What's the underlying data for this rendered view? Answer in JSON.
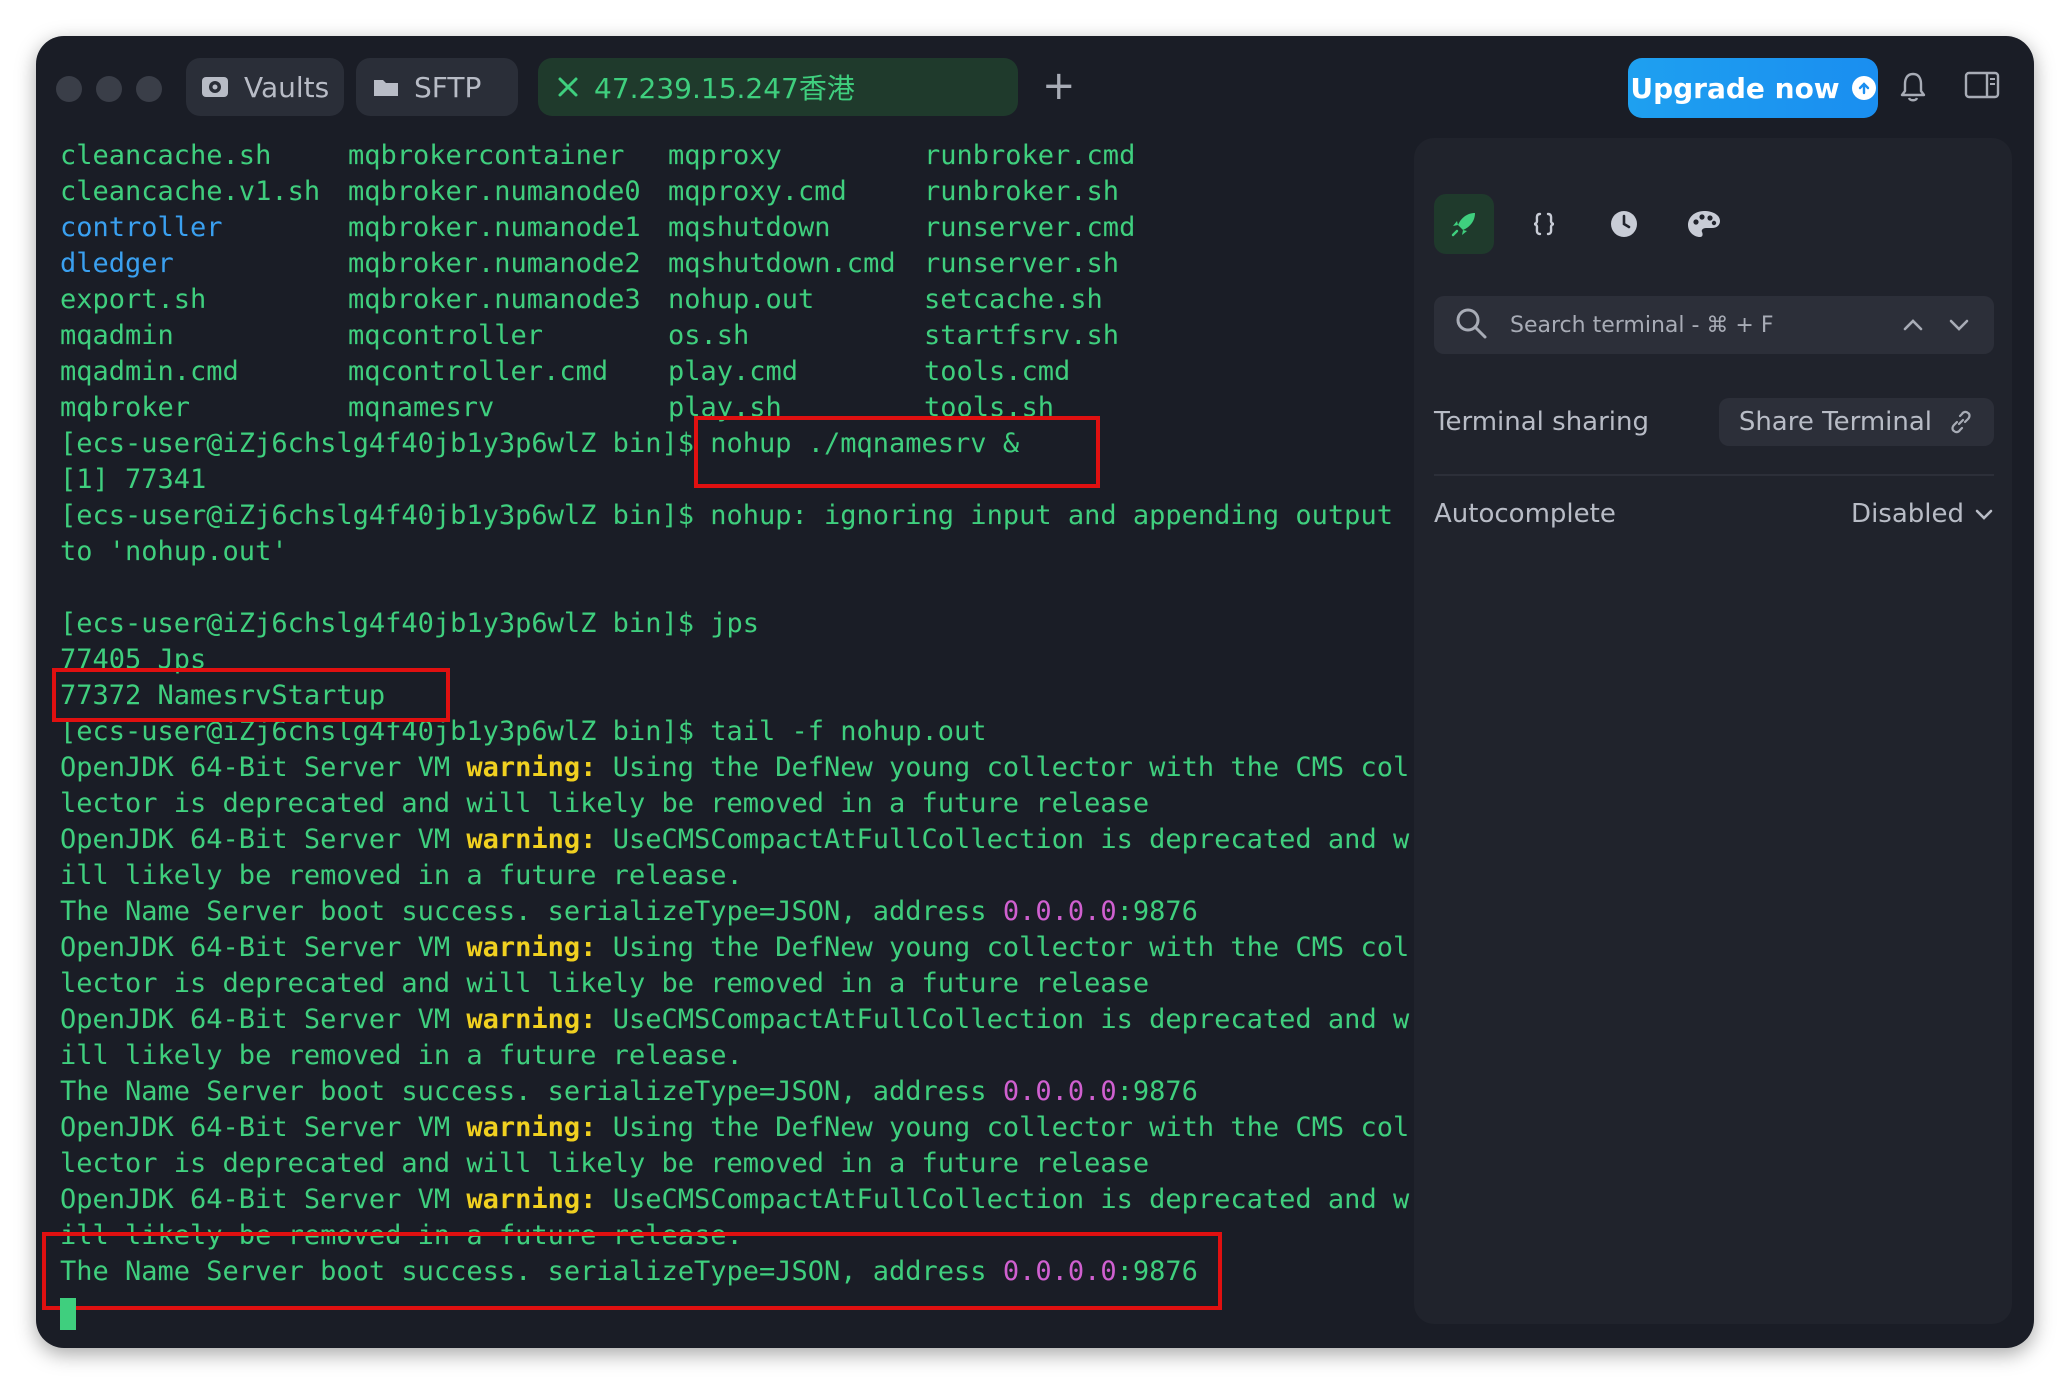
{
  "titlebar": {
    "tabs": [
      {
        "label": "Vaults",
        "icon": "vault-icon"
      },
      {
        "label": "SFTP",
        "icon": "folder-icon"
      },
      {
        "label": "47.239.15.247香港",
        "icon": "close-icon"
      }
    ],
    "upgrade_label": "Upgrade now"
  },
  "terminal": {
    "ls_columns": [
      [
        "cleancache.sh",
        "cleancache.v1.sh",
        "controller",
        "dledger",
        "export.sh",
        "mqadmin",
        "mqadmin.cmd",
        "mqbroker"
      ],
      [
        "mqbrokercontainer",
        "mqbroker.numanode0",
        "mqbroker.numanode1",
        "mqbroker.numanode2",
        "mqbroker.numanode3",
        "mqcontroller",
        "mqcontroller.cmd",
        "mqnamesrv"
      ],
      [
        "mqproxy",
        "mqproxy.cmd",
        "mqshutdown",
        "mqshutdown.cmd",
        "nohup.out",
        "os.sh",
        "play.cmd",
        "play.sh"
      ],
      [
        "runbroker.cmd",
        "runbroker.sh",
        "runserver.cmd",
        "runserver.sh",
        "setcache.sh",
        "startfsrv.sh",
        "tools.cmd",
        "tools.sh"
      ]
    ],
    "directories": [
      "controller",
      "dledger"
    ],
    "prompt": "[ecs-user@iZj6chslg4f40jb1y3p6wlZ bin]$",
    "cmd_nohup": " nohup ./mqnamesrv &",
    "job_line": "[1] 77341",
    "nohup_msg": " nohup: ignoring input and appending output",
    "nohup_msg2": "to 'nohup.out'",
    "cmd_jps": " jps",
    "jps_line1": "77405 Jps",
    "jps_line2": "77372 NamesrvStartup",
    "cmd_tail": " tail -f nohup.out",
    "vm_prefix": "OpenJDK 64-Bit Server VM ",
    "warn_word": "warning:",
    "warn1_rest": " Using the DefNew young collector with the CMS col",
    "warn1_cont": "lector is deprecated and will likely be removed in a future release",
    "warn2_rest": " UseCMSCompactAtFullCollection is deprecated and w",
    "warn2_cont": "ill likely be removed in a future release.",
    "boot_text": "The Name Server boot success. serializeType=JSON, address ",
    "boot_ip": "0.0.0.0",
    "boot_port": ":9876"
  },
  "panel": {
    "tools": [
      "rocket-icon",
      "braces-icon",
      "history-icon",
      "palette-icon"
    ],
    "search_placeholder": "Search terminal - ⌘ + F",
    "sharing_label": "Terminal sharing",
    "share_button": "Share Terminal",
    "autocomplete_label": "Autocomplete",
    "autocomplete_value": "Disabled"
  },
  "colors": {
    "terminal_text": "#3fcf7e",
    "directory": "#3aa0f0",
    "warning": "#f0d020",
    "address": "#d060d0",
    "highlight_box": "#e01010",
    "upgrade_button": "#1a8ef0"
  }
}
